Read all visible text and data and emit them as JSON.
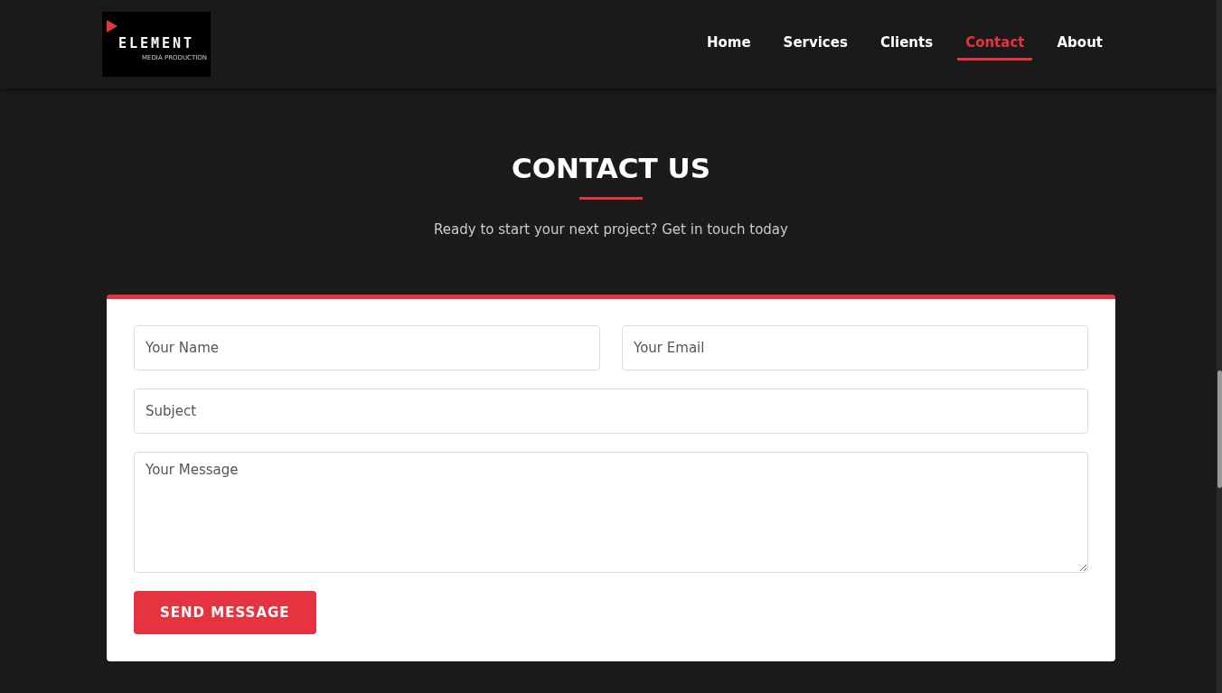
{
  "logo": {
    "name": "ELEMENT",
    "tagline": "MEDIA PRODUCTION"
  },
  "nav": [
    {
      "label": "Home",
      "selected": false
    },
    {
      "label": "Services",
      "selected": false
    },
    {
      "label": "Clients",
      "selected": false
    },
    {
      "label": "Contact",
      "selected": true
    },
    {
      "label": "About",
      "selected": false
    }
  ],
  "heading": "CONTACT US",
  "subtitle": "Ready to start your next project? Get in touch today",
  "form": {
    "name": {
      "placeholder": "Your Name"
    },
    "email": {
      "placeholder": "Your Email"
    },
    "subject": {
      "placeholder": "Subject"
    },
    "message": {
      "placeholder": "Your Message"
    },
    "submit": "SEND MESSAGE"
  }
}
